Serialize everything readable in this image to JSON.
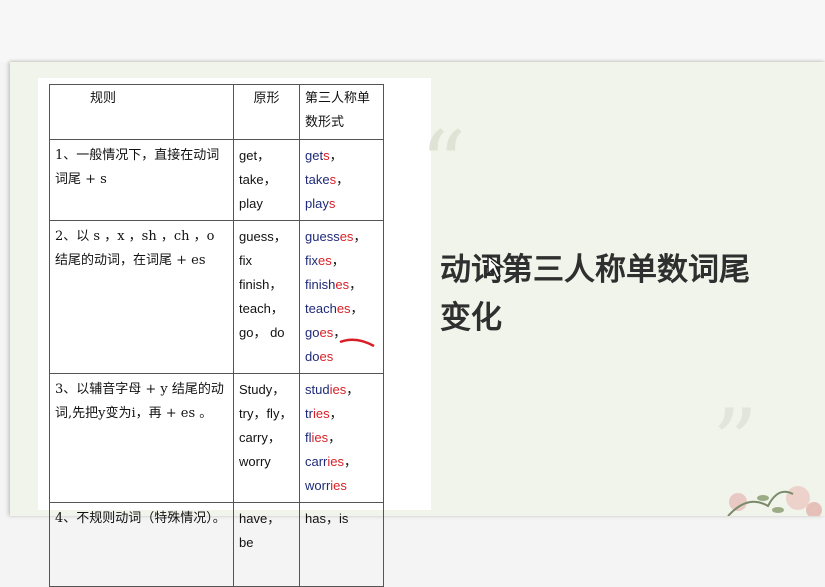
{
  "table": {
    "headers": [
      "规则",
      "原形",
      "第三人称单数形式"
    ],
    "rows": [
      {
        "rule": "1、一般情况下，直接在动词词尾 + s",
        "base": "get，take，play",
        "forms": [
          {
            "base": "get",
            "suffix": "s",
            "sep": "，"
          },
          {
            "base": "take",
            "suffix": "s",
            "sep": "，"
          },
          {
            "base": "play",
            "suffix": "s",
            "sep": ""
          }
        ]
      },
      {
        "rule": "2、以 s ，x ，sh ，ch ，o 结尾的动词，在词尾 + es",
        "base": "guess，fix finish， teach，go， do",
        "forms": [
          {
            "base": "guess",
            "suffix": "es",
            "sep": "，"
          },
          {
            "base": "fix",
            "suffix": "es",
            "sep": "，"
          },
          {
            "base": "finish",
            "suffix": "es",
            "sep": "，"
          },
          {
            "base": "teach",
            "suffix": "es",
            "sep": "，"
          },
          {
            "base": "go",
            "suffix": "es",
            "sep": "，"
          },
          {
            "base": "do",
            "suffix": "es",
            "sep": ""
          }
        ]
      },
      {
        "rule": "3、以辅音字母 + y 结尾的动词,先把y变为i，再 + es 。",
        "base": "Study， try，fly， carry， worry",
        "forms": [
          {
            "base": "stud",
            "suffix": "ies",
            "sep": "，"
          },
          {
            "base": "tr",
            "suffix": "ies",
            "sep": "，"
          },
          {
            "base": "fl",
            "suffix": "ies",
            "sep": "，"
          },
          {
            "base": "carr",
            "suffix": "ies",
            "sep": "，"
          },
          {
            "base": "worr",
            "suffix": "ies",
            "sep": ""
          }
        ]
      },
      {
        "rule": "4、不规则动词（特殊情况）。",
        "base": "have，be",
        "irregular": "has，is"
      }
    ]
  },
  "title": "动词第三人称单数词尾变化",
  "colors": {
    "base_word": "#1e2a78",
    "suffix": "#d81f26",
    "slide_bg": "#f1f4ea",
    "title": "#2f2f2f"
  },
  "icons": [
    "open-quote-icon",
    "close-quote-icon",
    "cursor-icon",
    "flower-decoration-icon"
  ]
}
